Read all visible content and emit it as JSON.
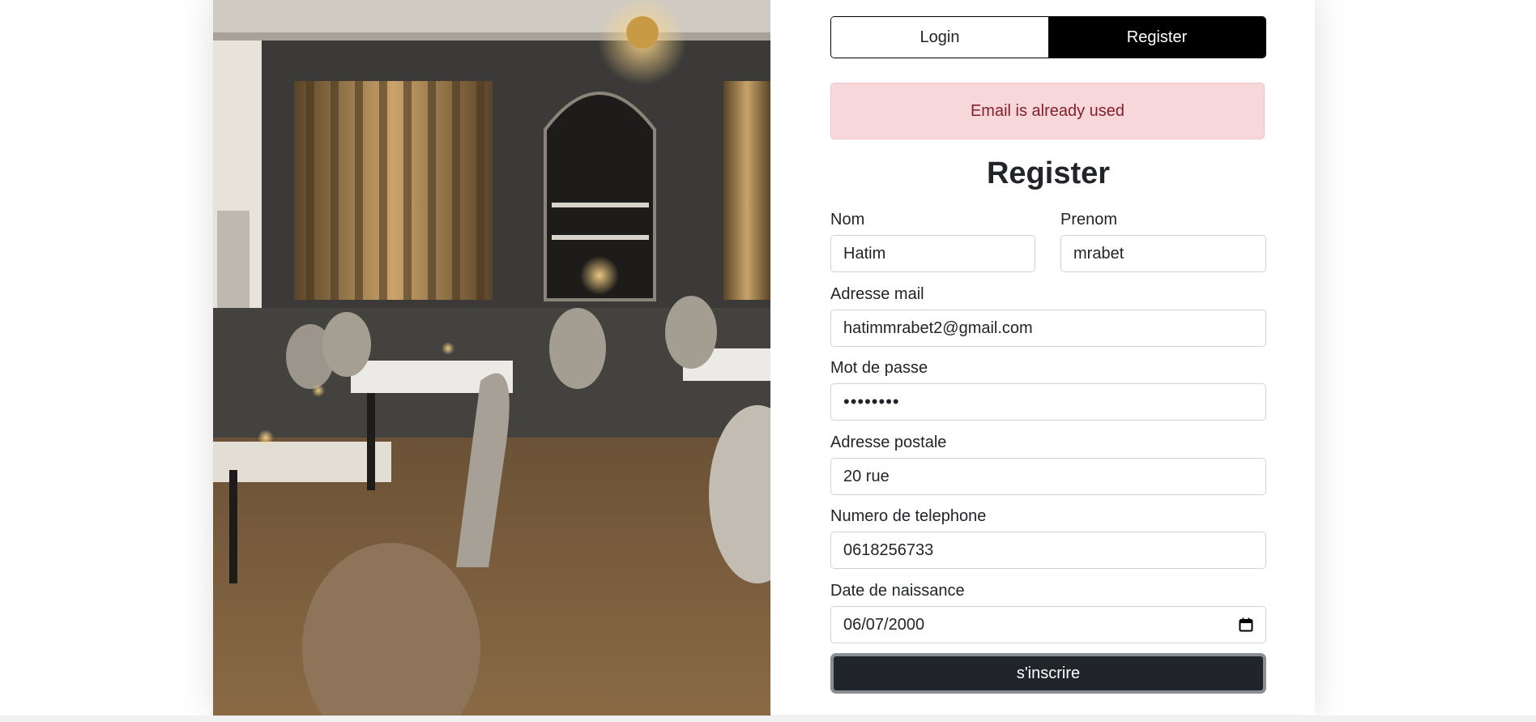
{
  "tabs": {
    "login_label": "Login",
    "register_label": "Register",
    "active": "Register"
  },
  "alert": {
    "message": "Email is already used"
  },
  "form": {
    "title": "Register",
    "fields": {
      "nom": {
        "label": "Nom",
        "value": "Hatim"
      },
      "prenom": {
        "label": "Prenom",
        "value": "mrabet"
      },
      "email": {
        "label": "Adresse mail",
        "value": "hatimmrabet2@gmail.com"
      },
      "password": {
        "label": "Mot de passe",
        "value": "••••••••"
      },
      "address": {
        "label": "Adresse postale",
        "value": "20 rue"
      },
      "phone": {
        "label": "Numero de telephone",
        "value": "0618256733"
      },
      "birthdate": {
        "label": "Date de naissance",
        "value": "06/07/2000"
      }
    },
    "submit_label": "s'inscrire"
  },
  "colors": {
    "alert_bg": "#f8d7da",
    "alert_text": "#842029",
    "tab_active_bg": "#000000",
    "submit_bg": "#212529"
  },
  "icons": {
    "date_picker": "calendar-icon"
  }
}
